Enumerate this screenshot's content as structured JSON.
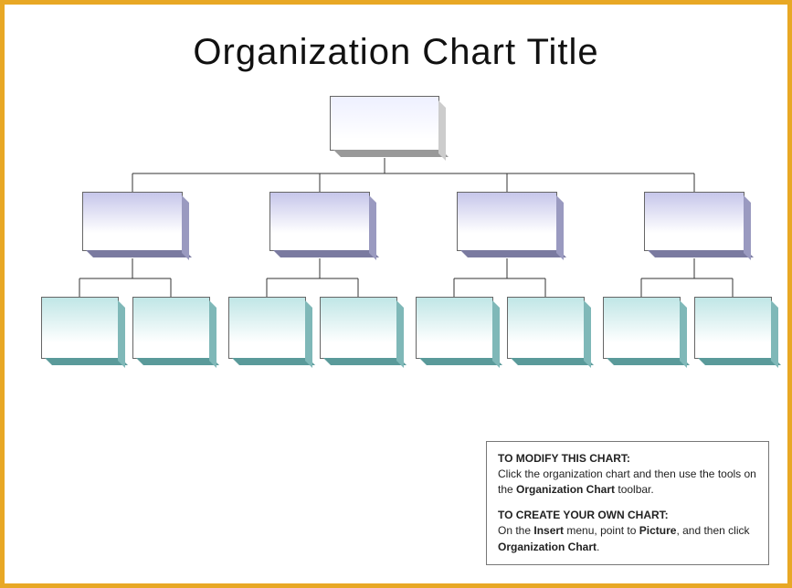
{
  "title": "Organization Chart Title",
  "chart_data": {
    "type": "org-chart",
    "root": {
      "label": ""
    },
    "mids": [
      {
        "label": ""
      },
      {
        "label": ""
      },
      {
        "label": ""
      },
      {
        "label": ""
      }
    ],
    "leaves": [
      {
        "label": ""
      },
      {
        "label": ""
      },
      {
        "label": ""
      },
      {
        "label": ""
      },
      {
        "label": ""
      },
      {
        "label": ""
      },
      {
        "label": ""
      },
      {
        "label": ""
      }
    ]
  },
  "info": {
    "modify_header": "TO MODIFY THIS CHART:",
    "modify_body_pre": "Click the organization chart and then use the tools on the ",
    "modify_body_bold": "Organization Chart",
    "modify_body_post": " toolbar.",
    "create_header": "TO CREATE YOUR OWN CHART:",
    "create_body_pre": "On the ",
    "create_body_b1": "Insert",
    "create_body_mid": " menu, point to ",
    "create_body_b2": "Picture",
    "create_body_mid2": ", and then click ",
    "create_body_b3": "Organization Chart",
    "create_body_post": "."
  }
}
